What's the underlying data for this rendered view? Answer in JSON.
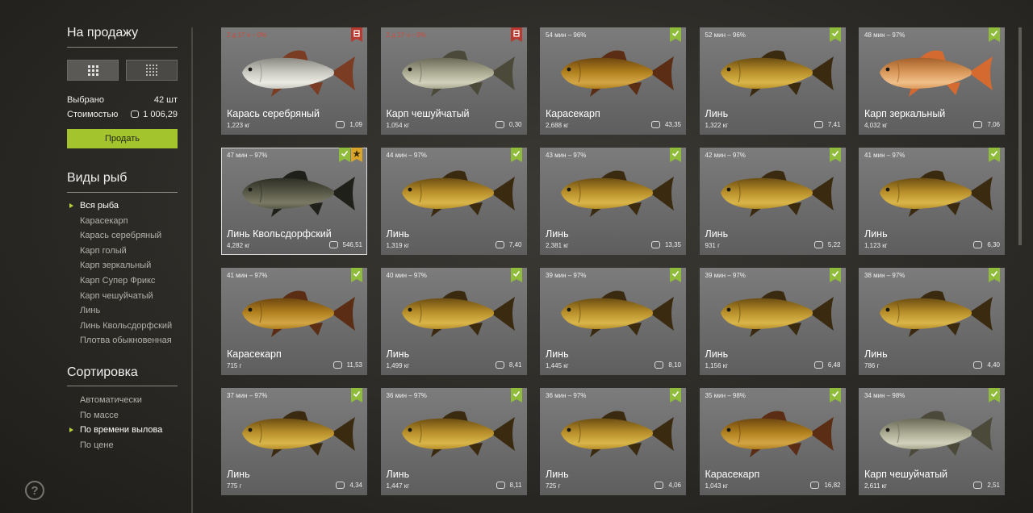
{
  "sidebar": {
    "sale_title": "На продажу",
    "selected_label": "Выбрано",
    "selected_value": "42 шт",
    "cost_label": "Стоимостью",
    "cost_value": "1 006,29",
    "sell_button": "Продать",
    "species_title": "Виды рыб",
    "species": [
      "Вся рыба",
      "Карасекарп",
      "Карась серебряный",
      "Карп голый",
      "Карп зеркальный",
      "Карп Супер Фрикс",
      "Карп чешуйчатый",
      "Линь",
      "Линь Квольсдорфский",
      "Плотва обыкновенная"
    ],
    "species_active_index": 0,
    "sort_title": "Сортировка",
    "sort_options": [
      "Автоматически",
      "По массе",
      "По времени вылова",
      "По цене"
    ],
    "sort_active_index": 2,
    "help_icon": "?"
  },
  "colors": {
    "accent_green": "#a3c42c",
    "tag_green": "#8fbc3a",
    "tag_red": "#b83a30",
    "tag_gold": "#d9a62a",
    "expired_text": "#d24a3c"
  },
  "fish_cards": [
    {
      "time": "2 д 17 ч – 0%",
      "expired": true,
      "name": "Карась серебряный",
      "weight": "1,223 кг",
      "price": "1,09",
      "tags": [
        "red"
      ],
      "fish": "silver",
      "selected": false
    },
    {
      "time": "2 д 17 ч – 0%",
      "expired": true,
      "name": "Карп чешуйчатый",
      "weight": "1,054 кг",
      "price": "0,30",
      "tags": [
        "red"
      ],
      "fish": "carp",
      "selected": false
    },
    {
      "time": "54 мин – 96%",
      "expired": false,
      "name": "Карасекарп",
      "weight": "2,688 кг",
      "price": "43,35",
      "tags": [
        "green"
      ],
      "fish": "crucian",
      "selected": false
    },
    {
      "time": "52 мин – 96%",
      "expired": false,
      "name": "Линь",
      "weight": "1,322 кг",
      "price": "7,41",
      "tags": [
        "green"
      ],
      "fish": "tench",
      "selected": false
    },
    {
      "time": "48 мин – 97%",
      "expired": false,
      "name": "Карп зеркальный",
      "weight": "4,032 кг",
      "price": "7,06",
      "tags": [
        "green"
      ],
      "fish": "mirror",
      "selected": false
    },
    {
      "time": "47 мин – 97%",
      "expired": false,
      "name": "Линь Квольсдорфский",
      "weight": "4,282 кг",
      "price": "546,51",
      "tags": [
        "green",
        "star"
      ],
      "fish": "dark",
      "selected": true
    },
    {
      "time": "44 мин – 97%",
      "expired": false,
      "name": "Линь",
      "weight": "1,319 кг",
      "price": "7,40",
      "tags": [
        "green"
      ],
      "fish": "tench",
      "selected": false
    },
    {
      "time": "43 мин – 97%",
      "expired": false,
      "name": "Линь",
      "weight": "2,381 кг",
      "price": "13,35",
      "tags": [
        "green"
      ],
      "fish": "tench",
      "selected": false
    },
    {
      "time": "42 мин – 97%",
      "expired": false,
      "name": "Линь",
      "weight": "931 г",
      "price": "5,22",
      "tags": [
        "green"
      ],
      "fish": "tench",
      "selected": false
    },
    {
      "time": "41 мин – 97%",
      "expired": false,
      "name": "Линь",
      "weight": "1,123 кг",
      "price": "6,30",
      "tags": [
        "green"
      ],
      "fish": "tench",
      "selected": false
    },
    {
      "time": "41 мин – 97%",
      "expired": false,
      "name": "Карасекарп",
      "weight": "715 г",
      "price": "11,53",
      "tags": [
        "green"
      ],
      "fish": "crucian",
      "selected": false
    },
    {
      "time": "40 мин – 97%",
      "expired": false,
      "name": "Линь",
      "weight": "1,499 кг",
      "price": "8,41",
      "tags": [
        "green"
      ],
      "fish": "tench",
      "selected": false
    },
    {
      "time": "39 мин – 97%",
      "expired": false,
      "name": "Линь",
      "weight": "1,445 кг",
      "price": "8,10",
      "tags": [
        "green"
      ],
      "fish": "tench",
      "selected": false
    },
    {
      "time": "39 мин – 97%",
      "expired": false,
      "name": "Линь",
      "weight": "1,156 кг",
      "price": "6,48",
      "tags": [
        "green"
      ],
      "fish": "tench",
      "selected": false
    },
    {
      "time": "38 мин – 97%",
      "expired": false,
      "name": "Линь",
      "weight": "786 г",
      "price": "4,40",
      "tags": [
        "green"
      ],
      "fish": "tench",
      "selected": false
    },
    {
      "time": "37 мин – 97%",
      "expired": false,
      "name": "Линь",
      "weight": "775 г",
      "price": "4,34",
      "tags": [
        "green"
      ],
      "fish": "tench",
      "selected": false
    },
    {
      "time": "36 мин – 97%",
      "expired": false,
      "name": "Линь",
      "weight": "1,447 кг",
      "price": "8,11",
      "tags": [
        "green"
      ],
      "fish": "tench",
      "selected": false
    },
    {
      "time": "36 мин – 97%",
      "expired": false,
      "name": "Линь",
      "weight": "725 г",
      "price": "4,06",
      "tags": [
        "green"
      ],
      "fish": "tench",
      "selected": false
    },
    {
      "time": "35 мин – 98%",
      "expired": false,
      "name": "Карасекарп",
      "weight": "1,043 кг",
      "price": "16,82",
      "tags": [
        "green"
      ],
      "fish": "crucian",
      "selected": false
    },
    {
      "time": "34 мин – 98%",
      "expired": false,
      "name": "Карп чешуйчатый",
      "weight": "2,611 кг",
      "price": "2,51",
      "tags": [
        "green"
      ],
      "fish": "carp",
      "selected": false
    }
  ]
}
